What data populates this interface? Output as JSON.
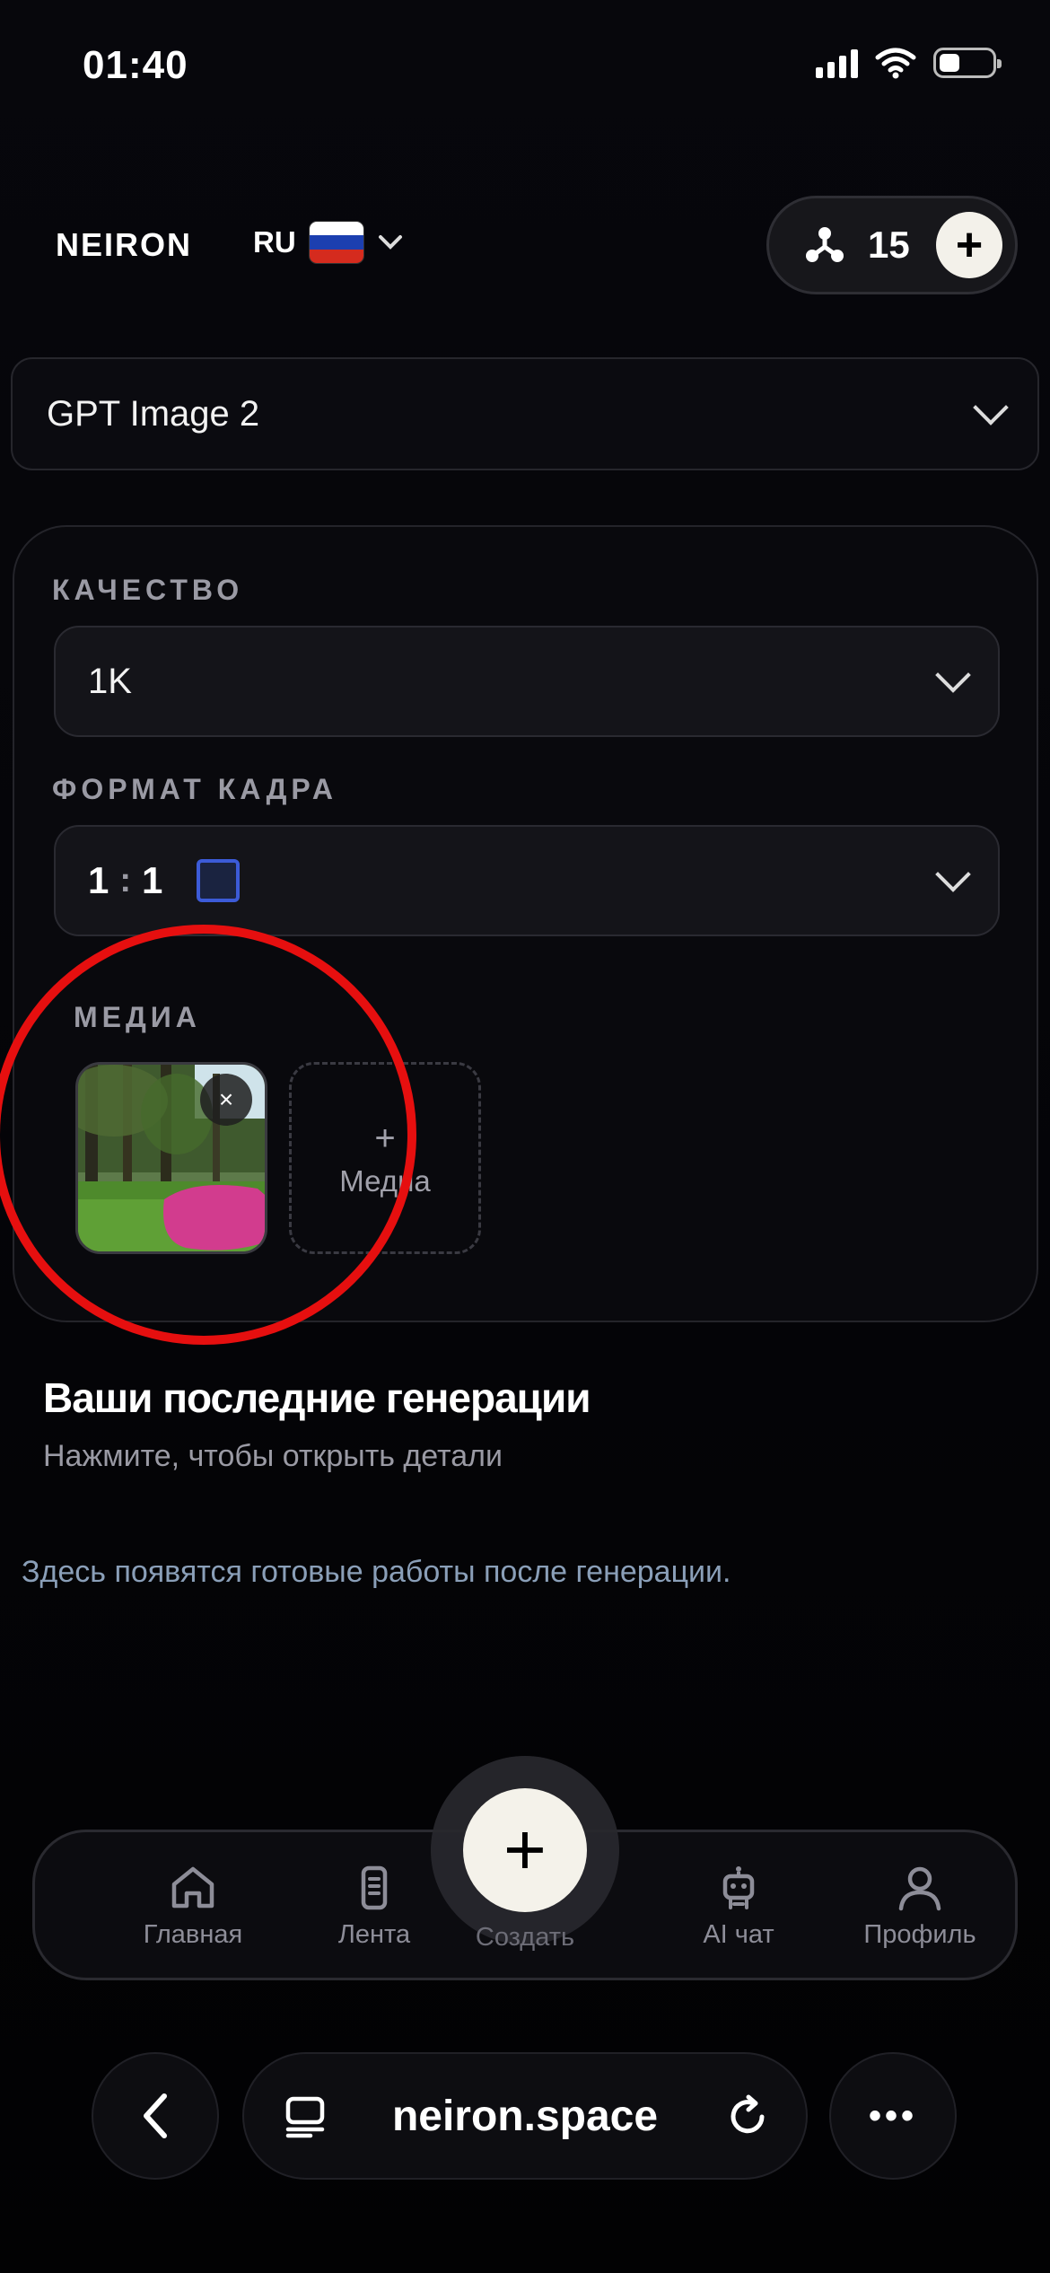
{
  "status_bar": {
    "time": "01:40"
  },
  "header": {
    "logo": "NEIRON",
    "language_code": "RU",
    "credits": "15",
    "add_label": "+"
  },
  "model_selector": {
    "value": "GPT Image 2"
  },
  "settings": {
    "quality": {
      "label": "КАЧЕСТВО",
      "value": "1K"
    },
    "aspect": {
      "label": "ФОРМАТ КАДРА",
      "left": "1",
      "separator": ":",
      "right": "1"
    },
    "media": {
      "label": "МЕДИА",
      "remove_label": "×",
      "add_plus": "+",
      "add_label": "Медиа"
    }
  },
  "recent": {
    "title": "Ваши последние генерации",
    "subtitle": "Нажмите, чтобы открыть детали",
    "empty": "Здесь появятся готовые работы после генерации."
  },
  "bottom_nav": {
    "home": "Главная",
    "feed": "Лента",
    "create": "Создать",
    "create_icon": "+",
    "ai_chat": "AI чат",
    "profile": "Профиль"
  },
  "browser": {
    "url": "neiron.space",
    "more": "•••"
  },
  "colors": {
    "accent_red": "#e60f0f",
    "ratio_blue": "#3c5bd8",
    "flag": [
      "#ffffff",
      "#1c3fb0",
      "#d52b1e"
    ]
  }
}
